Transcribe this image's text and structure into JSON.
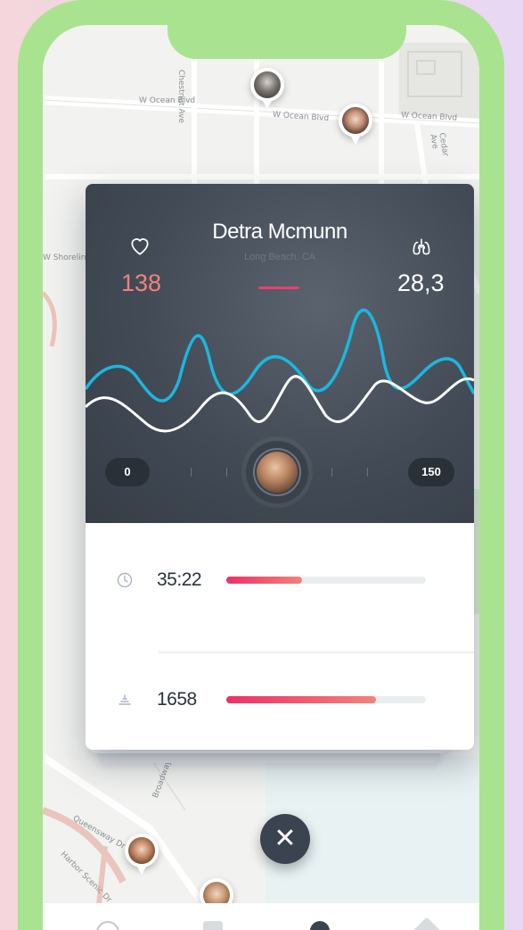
{
  "map": {
    "roads": [
      "W Ocean Blvd",
      "W Ocean Blvd",
      "W Ocean Blvd",
      "Chestnut Ave",
      "Cedar Ave",
      "W Shoreline Dr",
      "Queensway Dr",
      "Harbor Scenic Dr",
      "Broadway"
    ]
  },
  "profile": {
    "name": "Detra Mcmunn",
    "location": "Long Beach, CA"
  },
  "stats": {
    "heart_rate": "138",
    "lungs": "28,3",
    "heart_icon": "heart-icon",
    "lungs_icon": "lungs-icon",
    "heart_color": "#f0837a"
  },
  "slider": {
    "min_label": "0",
    "max_label": "150"
  },
  "metrics": [
    {
      "icon": "clock-icon",
      "value": "35:22",
      "fill": 0.38
    },
    {
      "icon": "distance-icon",
      "value": "1658",
      "fill": 0.75
    }
  ],
  "colors": {
    "accent": "#ec3f6b",
    "wave_blue": "#1bb7df",
    "wave_white": "#ffffff",
    "phone_frame": "#a9e38f"
  },
  "close_icon": "close-icon"
}
